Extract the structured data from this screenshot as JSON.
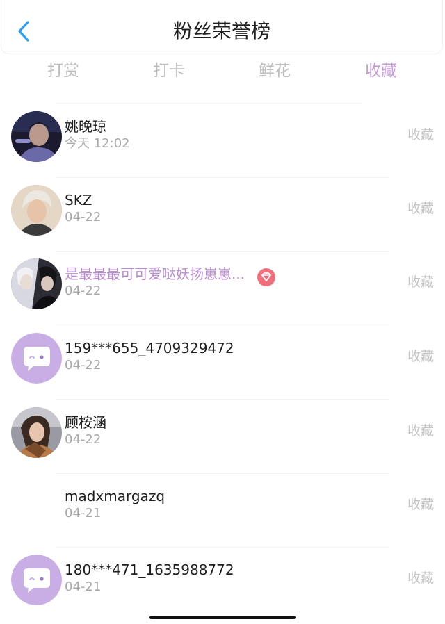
{
  "header": {
    "title": "粉丝荣誉榜"
  },
  "tabs": [
    {
      "label": "打赏"
    },
    {
      "label": "打卡"
    },
    {
      "label": "鲜花"
    },
    {
      "label": "收藏"
    }
  ],
  "active_tab": "收藏",
  "colors": {
    "accent": "#c49ad8",
    "vip_name": "#b88ad2",
    "back_icon": "#2a9df4",
    "muted_text": "#a8a8a8",
    "badge": "#f06f7c"
  },
  "fans": [
    {
      "name": "姚晚琼",
      "date": "今天 12:02",
      "action": "收藏",
      "avatar": "photo"
    },
    {
      "name": "SKZ",
      "date": "04-22",
      "action": "收藏",
      "avatar": "photo"
    },
    {
      "name": "是最最最可可爱哒妖扬崽崽...",
      "date": "04-22",
      "action": "收藏",
      "avatar": "illustration",
      "badge_icon": "diamond-badge-icon"
    },
    {
      "name": "159***655_4709329472",
      "date": "04-22",
      "action": "收藏",
      "avatar": "default-chat-bubble"
    },
    {
      "name": "顾桉涵",
      "date": "04-22",
      "action": "收藏",
      "avatar": "photo"
    },
    {
      "name": "madxmargazq",
      "date": "04-21",
      "action": "收藏",
      "avatar": "none"
    },
    {
      "name": "180***471_1635988772",
      "date": "04-21",
      "action": "收藏",
      "avatar": "default-chat-bubble"
    }
  ]
}
